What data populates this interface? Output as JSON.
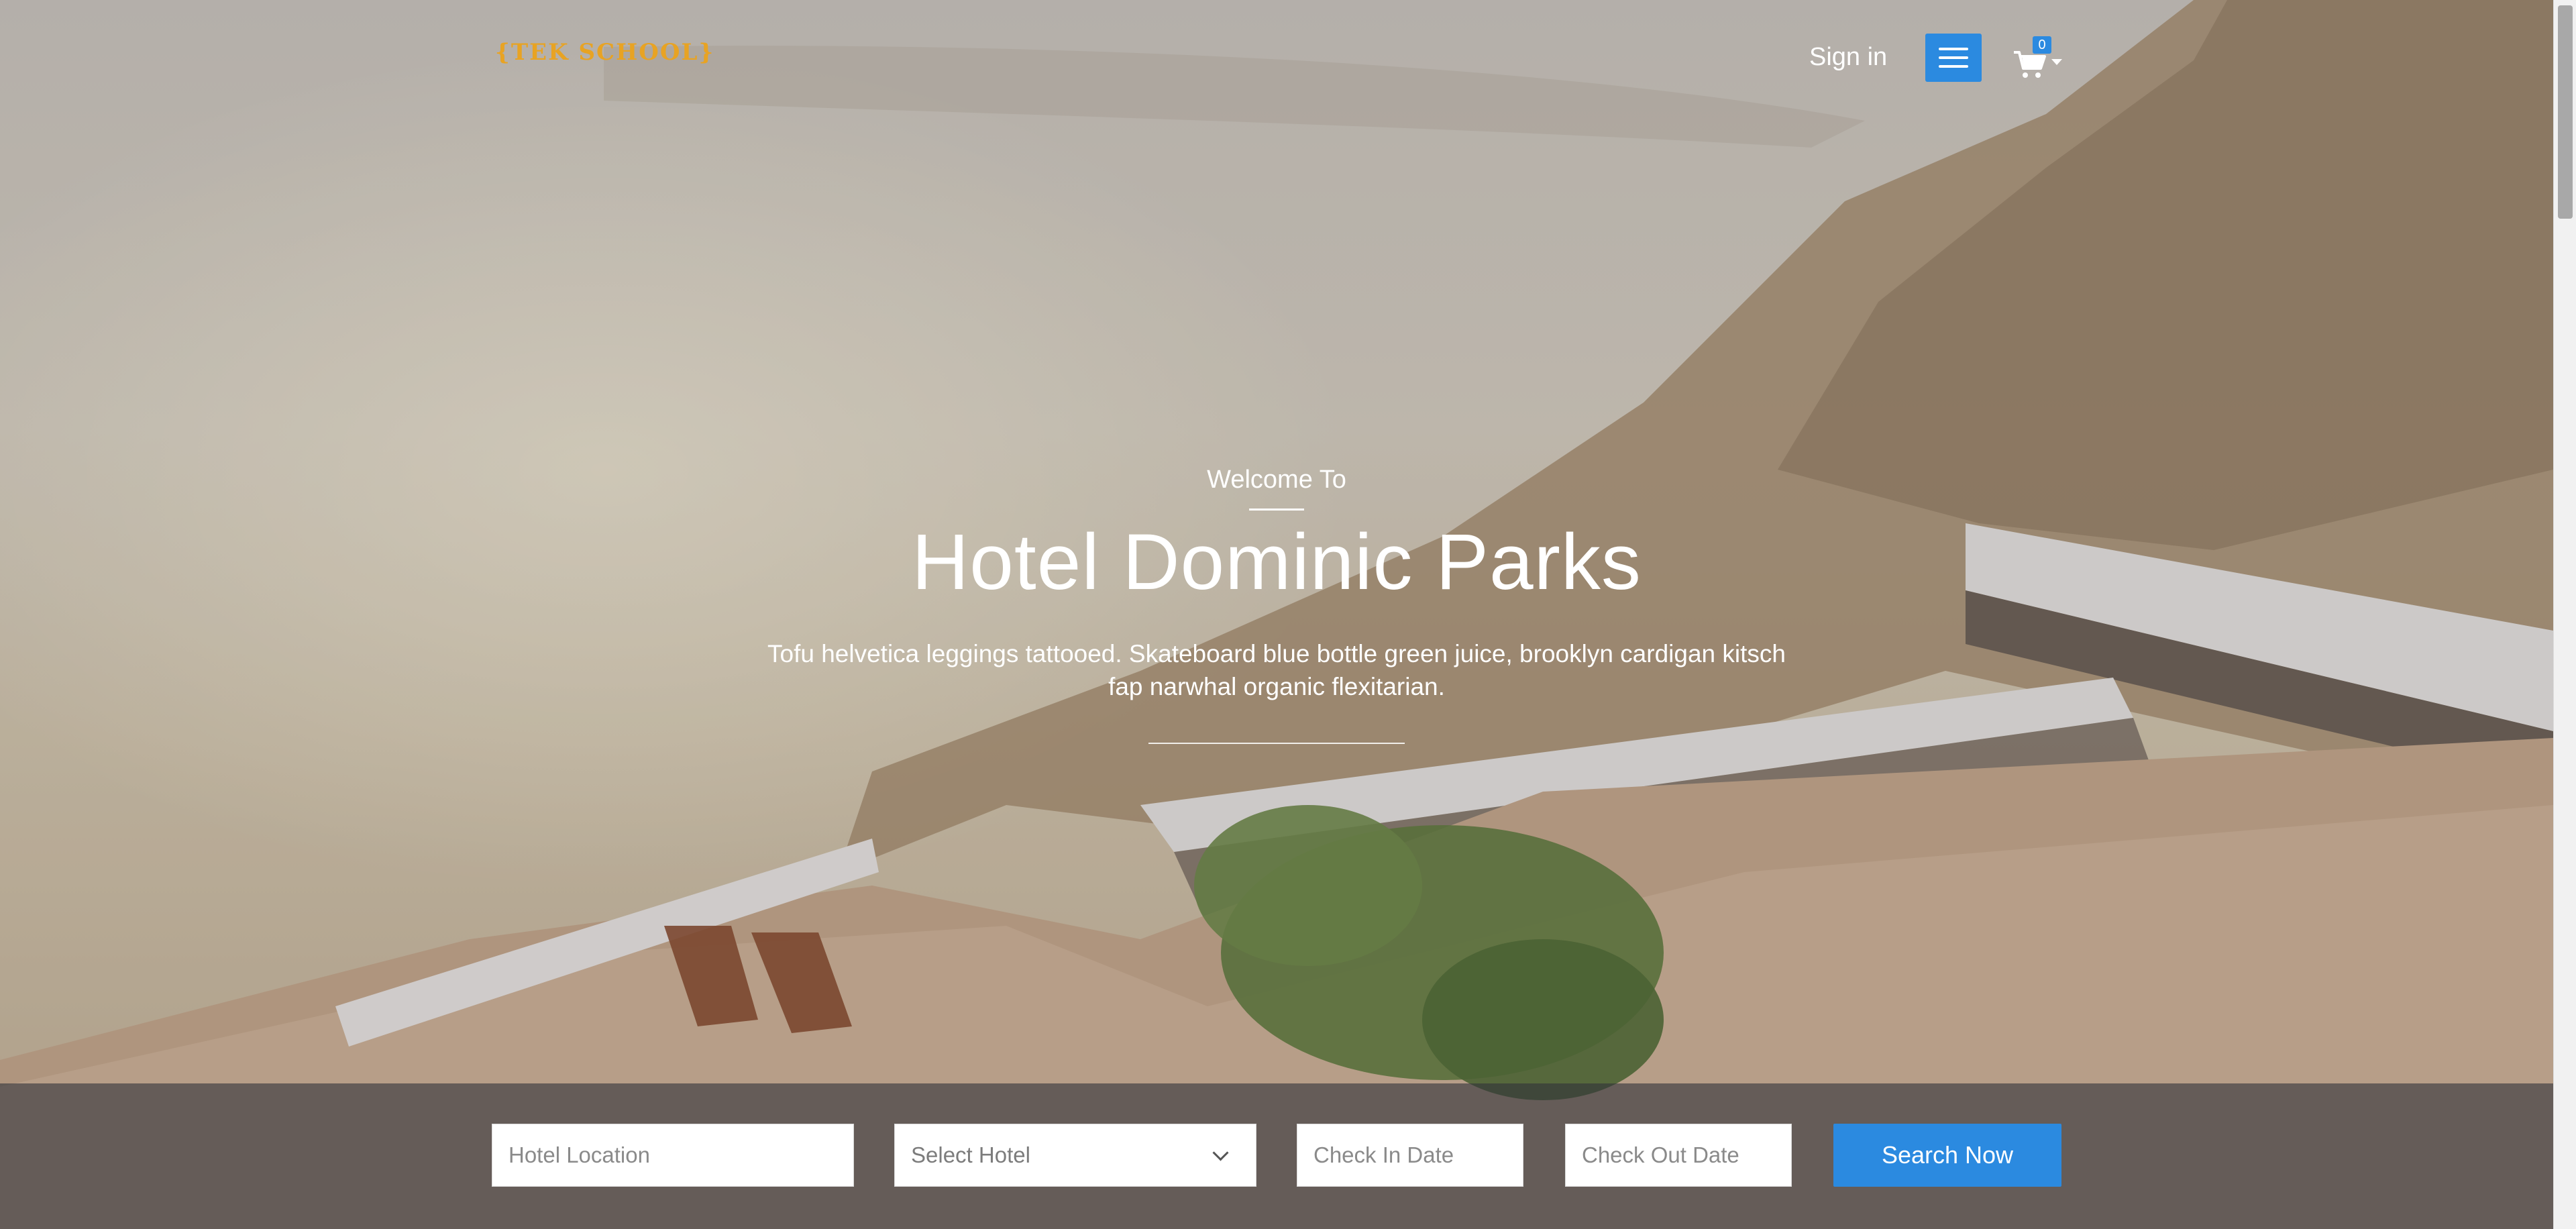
{
  "header": {
    "logo_text": "{TEK SCHOOL}",
    "signin_label": "Sign in",
    "menu_icon": "hamburger-icon",
    "cart_icon": "shopping-cart-icon",
    "cart_count": "0"
  },
  "hero": {
    "welcome": "Welcome To",
    "title": "Hotel Dominic Parks",
    "tagline": "Tofu helvetica leggings tattooed. Skateboard blue bottle green juice, brooklyn cardigan kitsch fap narwhal organic flexitarian."
  },
  "search": {
    "location_placeholder": "Hotel Location",
    "hotel_select_value": "Select Hotel",
    "checkin_placeholder": "Check In Date",
    "checkout_placeholder": "Check Out Date",
    "submit_label": "Search Now"
  },
  "colors": {
    "accent": "#2b8ae0",
    "logo": "#e8a323"
  }
}
